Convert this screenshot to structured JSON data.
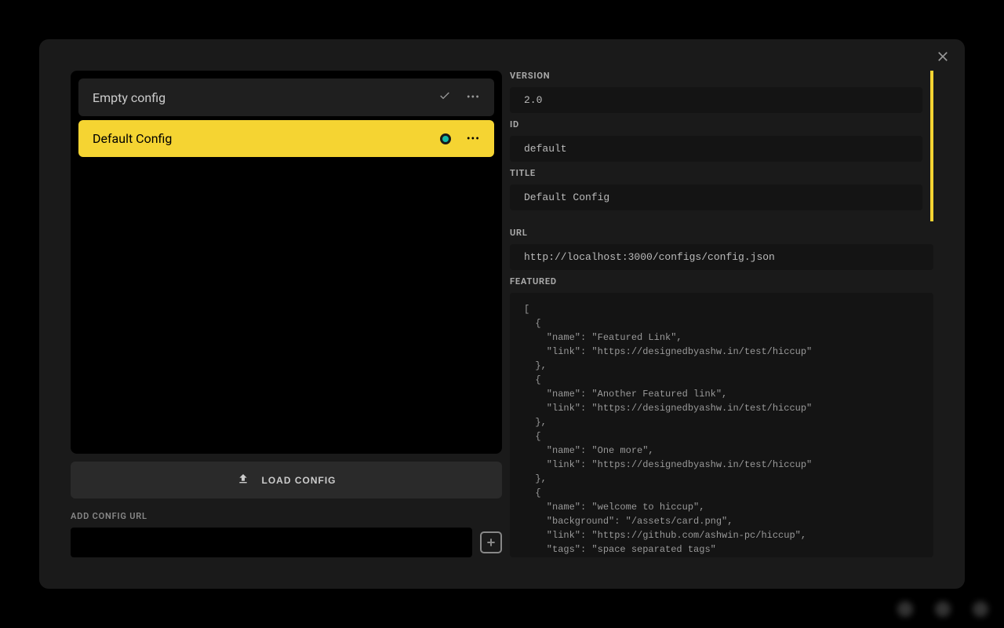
{
  "configs": [
    {
      "name": "Empty config",
      "active": false
    },
    {
      "name": "Default Config",
      "active": true
    }
  ],
  "buttons": {
    "load_config": "LOAD CONFIG",
    "add_url_label": "ADD CONFIG URL"
  },
  "details": {
    "labels": {
      "version": "VERSION",
      "id": "ID",
      "title": "TITLE",
      "url": "URL",
      "featured": "FEATURED"
    },
    "version": "2.0",
    "id": "default",
    "title": "Default Config",
    "url": "http://localhost:3000/configs/config.json",
    "featured": "[\n  {\n    \"name\": \"Featured Link\",\n    \"link\": \"https://designedbyashw.in/test/hiccup\"\n  },\n  {\n    \"name\": \"Another Featured link\",\n    \"link\": \"https://designedbyashw.in/test/hiccup\"\n  },\n  {\n    \"name\": \"One more\",\n    \"link\": \"https://designedbyashw.in/test/hiccup\"\n  },\n  {\n    \"name\": \"welcome to hiccup\",\n    \"background\": \"/assets/card.png\",\n    \"link\": \"https://github.com/ashwin-pc/hiccup\",\n    \"tags\": \"space separated tags\""
  },
  "url_input_value": ""
}
